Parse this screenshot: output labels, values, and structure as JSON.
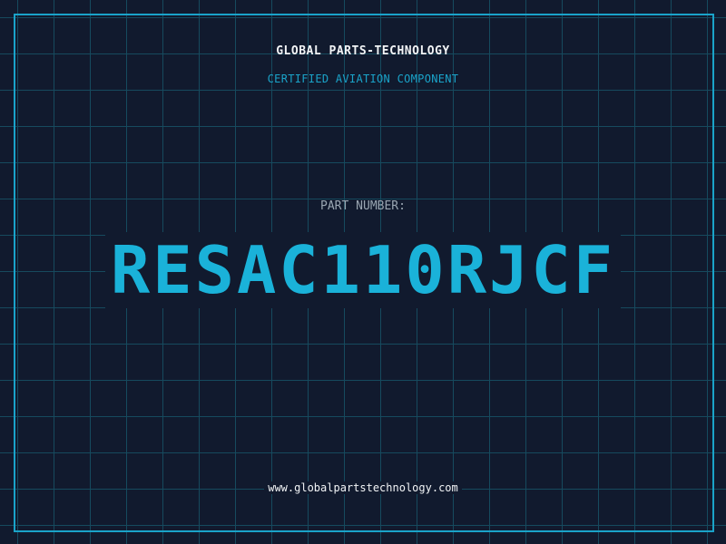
{
  "header": {
    "company": "GLOBAL PARTS-TECHNOLOGY",
    "subtitle": "CERTIFIED AVIATION COMPONENT"
  },
  "part": {
    "label": "PART NUMBER:",
    "number": "RESAC110RJCF"
  },
  "footer": {
    "website": "www.globalpartstechnology.com"
  },
  "colors": {
    "background": "#111a2e",
    "grid": "#164a5e",
    "accent": "#1ab2d9",
    "frame": "#1aa3c9",
    "text_light": "#f2f4f6",
    "text_muted": "#9aa6b2"
  }
}
